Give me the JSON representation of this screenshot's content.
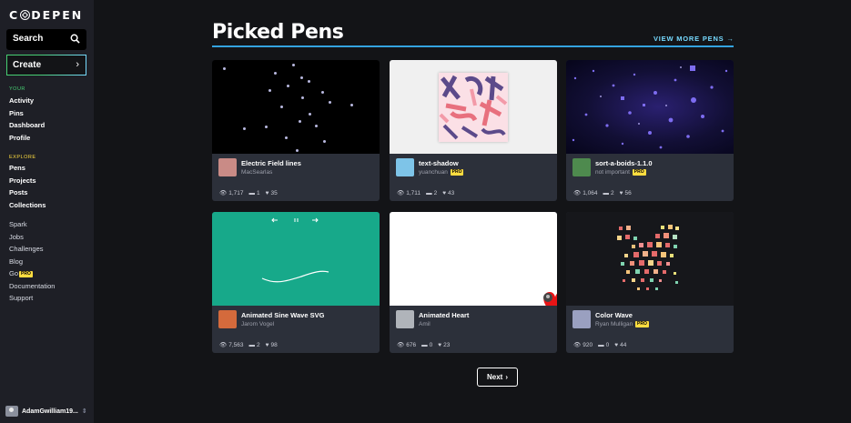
{
  "brand": {
    "logo_text": "CODEPEN"
  },
  "sidebar": {
    "search_label": "Search",
    "create_label": "Create",
    "your_label": "YOUR",
    "your_items": [
      "Activity",
      "Pins",
      "Dashboard",
      "Profile"
    ],
    "explore_label": "EXPLORE",
    "explore_items": [
      "Pens",
      "Projects",
      "Posts",
      "Collections"
    ],
    "misc_items": [
      "Spark",
      "Jobs",
      "Challenges",
      "Blog",
      "Go",
      "Documentation",
      "Support"
    ],
    "go_badge": "PRO",
    "username": "AdamGwilliam19..."
  },
  "main": {
    "title": "Picked Pens",
    "view_more": "VIEW MORE PENS →",
    "next_label": "Next",
    "pro_badge": "PRO",
    "cards": [
      {
        "name": "Electric Field lines",
        "author": "MacSearlas",
        "views": "1,717",
        "comments": "1",
        "likes": "35",
        "pro": false
      },
      {
        "name": "text-shadow",
        "author": "yuanchuan",
        "views": "1,711",
        "comments": "2",
        "likes": "43",
        "pro": true
      },
      {
        "name": "sort-a-boids-1.1.0",
        "author": "not important",
        "views": "1,064",
        "comments": "2",
        "likes": "56",
        "pro": true
      },
      {
        "name": "Animated Sine Wave SVG",
        "author": "Jarom Vogel",
        "views": "7,563",
        "comments": "2",
        "likes": "98",
        "pro": false
      },
      {
        "name": "Animated Heart",
        "author": "Amil",
        "views": "676",
        "comments": "0",
        "likes": "23",
        "pro": false
      },
      {
        "name": "Color Wave",
        "author": "Ryan Mulligan",
        "views": "920",
        "comments": "0",
        "likes": "44",
        "pro": true
      }
    ]
  },
  "colors": {
    "accent_green": "#47cf73",
    "accent_blue": "#34a3e0",
    "pro_yellow": "#ffdd40",
    "card_bg": "#2c303a"
  }
}
